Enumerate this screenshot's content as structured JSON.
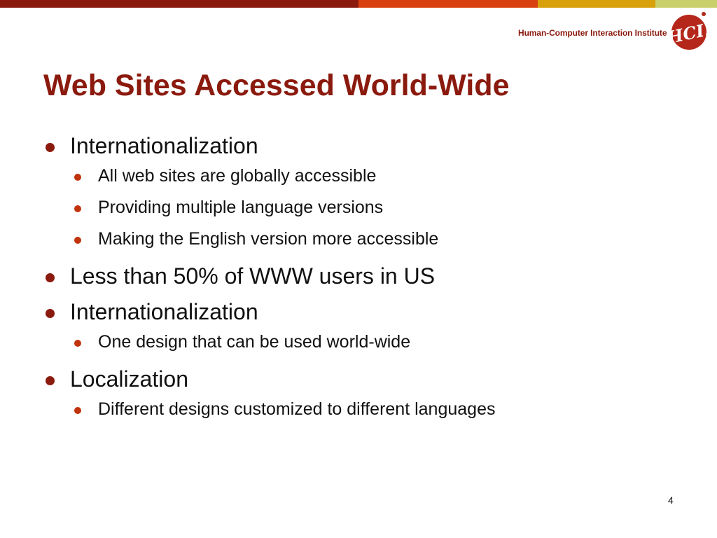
{
  "colors": {
    "title": "#8b1a0e",
    "bar_segments": [
      "#8b1a0e",
      "#d9400f",
      "#d8a00a",
      "#c8cf6b"
    ],
    "bullet": "#8b1a0e"
  },
  "header": {
    "institute": "Human-Computer Interaction Institute",
    "logo_text": "HCI!"
  },
  "slide": {
    "title": "Web Sites Accessed World-Wide",
    "items": [
      {
        "text": "Internationalization",
        "sub": [
          "All web sites are globally accessible",
          "Providing multiple language versions",
          "Making the English version more accessible"
        ]
      },
      {
        "text": "Less than 50% of WWW users in US",
        "sub": []
      },
      {
        "text": "Internationalization",
        "sub": [
          "One design that can be used world-wide"
        ]
      },
      {
        "text": "Localization",
        "sub": [
          "Different designs customized to different languages"
        ]
      }
    ],
    "page_number": "4"
  }
}
